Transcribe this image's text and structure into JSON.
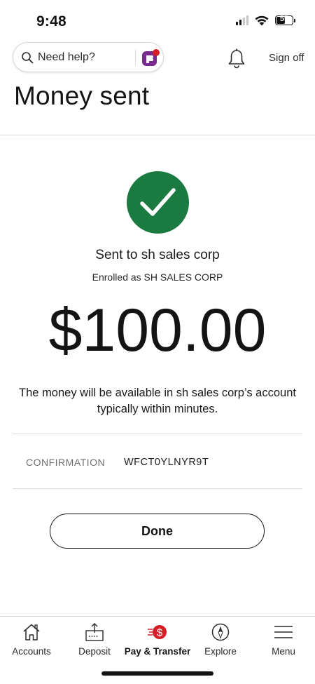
{
  "status_bar": {
    "time": "9:48",
    "battery_level": "55",
    "icons": [
      "cellular-signal-icon",
      "wifi-icon",
      "battery-icon"
    ]
  },
  "header": {
    "search_placeholder": "Need help?",
    "search_icon": "search-icon",
    "assistant_icon": "fargo-assistant-icon",
    "notification_icon": "bell-icon",
    "sign_off_label": "Sign off"
  },
  "page": {
    "title": "Money sent"
  },
  "confirmation": {
    "status_icon": "checkmark-icon",
    "status_color": "#1a7a3f",
    "sent_to": "Sent to sh sales corp",
    "enrolled_as": "Enrolled as SH SALES CORP",
    "amount": "$100.00",
    "availability_message": "The money will be available in sh sales corp’s account typically within minutes.",
    "confirmation_label": "CONFIRMATION",
    "confirmation_number": "WFCT0YLNYR9T",
    "done_label": "Done"
  },
  "bottom_nav": {
    "items": [
      {
        "label": "Accounts",
        "icon": "home-icon",
        "active": false
      },
      {
        "label": "Deposit",
        "icon": "deposit-icon",
        "active": false
      },
      {
        "label": "Pay & Transfer",
        "icon": "pay-transfer-icon",
        "active": true
      },
      {
        "label": "Explore",
        "icon": "compass-icon",
        "active": false
      },
      {
        "label": "Menu",
        "icon": "hamburger-menu-icon",
        "active": false
      }
    ],
    "accent_color": "#d71e28"
  }
}
